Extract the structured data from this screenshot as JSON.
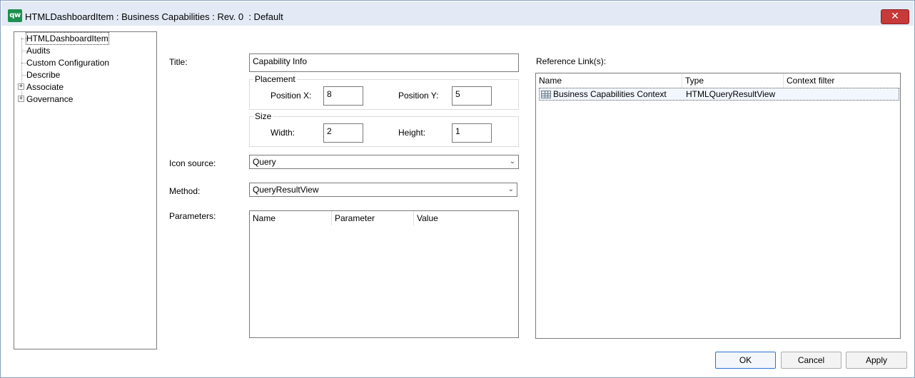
{
  "window": {
    "app_icon_text": "qw",
    "title": "HTMLDashboardItem : Business Capabilities : Rev. 0  : Default",
    "close_symbol": "✕"
  },
  "tree": {
    "items": [
      {
        "label": "HTMLDashboardItem",
        "expandable": false,
        "selected": true
      },
      {
        "label": "Audits",
        "expandable": false
      },
      {
        "label": "Custom Configuration",
        "expandable": false
      },
      {
        "label": "Describe",
        "expandable": false
      },
      {
        "label": "Associate",
        "expandable": true
      },
      {
        "label": "Governance",
        "expandable": true
      }
    ],
    "expander_symbol": "+"
  },
  "form": {
    "title_label": "Title:",
    "title_value": "Capability Info",
    "placement": {
      "legend": "Placement",
      "position_x_label": "Position X:",
      "position_x_value": "8",
      "position_y_label": "Position Y:",
      "position_y_value": "5"
    },
    "size": {
      "legend": "Size",
      "width_label": "Width:",
      "width_value": "2",
      "height_label": "Height:",
      "height_value": "1"
    },
    "icon_source_label": "Icon source:",
    "icon_source_value": "Query",
    "method_label": "Method:",
    "method_value": "QueryResultView",
    "parameters_label": "Parameters:",
    "parameters_columns": [
      "Name",
      "Parameter",
      "Value"
    ]
  },
  "reference_links": {
    "label": "Reference Link(s):",
    "columns": [
      "Name",
      "Type",
      "Context filter"
    ],
    "rows": [
      {
        "name": "Business Capabilities Context",
        "type": "HTMLQueryResultView",
        "context_filter": ""
      }
    ]
  },
  "buttons": {
    "ok": "OK",
    "cancel": "Cancel",
    "apply": "Apply"
  },
  "icons": {
    "dropdown": "chevron-down-icon",
    "row_icon": "grid-table-icon",
    "close": "close-icon",
    "expander": "plus-box-icon"
  }
}
